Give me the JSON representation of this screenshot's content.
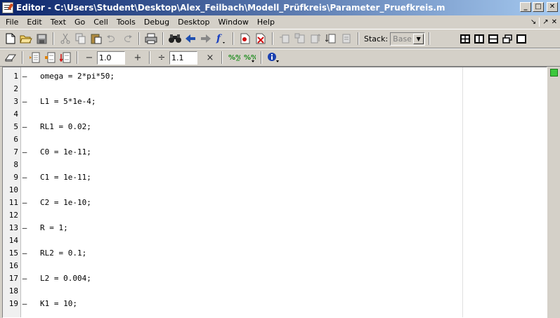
{
  "window": {
    "title": "Editor - C:\\Users\\Student\\Desktop\\Alex_Feilbach\\Modell_Prüfkreis\\Parameter_Pruefkreis.m",
    "minimize": "_",
    "maximize": "□",
    "close": "✕"
  },
  "menu": {
    "items": [
      "File",
      "Edit",
      "Text",
      "Go",
      "Cell",
      "Tools",
      "Debug",
      "Desktop",
      "Window",
      "Help"
    ],
    "right_icons": [
      "↘",
      "↗",
      "✕"
    ]
  },
  "toolbar": {
    "stack_label": "Stack:",
    "stack_value": "Base",
    "minus": "−",
    "step1_value": "1.0",
    "plus": "+",
    "divide": "÷",
    "step2_value": "1.1",
    "times": "×"
  },
  "editor": {
    "lines": [
      {
        "num": "1",
        "bp": "–",
        "code": "omega = 2*pi*50;"
      },
      {
        "num": "2",
        "bp": "",
        "code": ""
      },
      {
        "num": "3",
        "bp": "–",
        "code": "L1 = 5*1e-4;"
      },
      {
        "num": "4",
        "bp": "",
        "code": ""
      },
      {
        "num": "5",
        "bp": "–",
        "code": "RL1 = 0.02;"
      },
      {
        "num": "6",
        "bp": "",
        "code": ""
      },
      {
        "num": "7",
        "bp": "–",
        "code": "C0 = 1e-11;"
      },
      {
        "num": "8",
        "bp": "",
        "code": ""
      },
      {
        "num": "9",
        "bp": "–",
        "code": "C1 = 1e-11;"
      },
      {
        "num": "10",
        "bp": "",
        "code": ""
      },
      {
        "num": "11",
        "bp": "–",
        "code": "C2 = 1e-10;"
      },
      {
        "num": "12",
        "bp": "",
        "code": ""
      },
      {
        "num": "13",
        "bp": "–",
        "code": "R = 1;"
      },
      {
        "num": "14",
        "bp": "",
        "code": ""
      },
      {
        "num": "15",
        "bp": "–",
        "code": "RL2 = 0.1;"
      },
      {
        "num": "16",
        "bp": "",
        "code": ""
      },
      {
        "num": "17",
        "bp": "–",
        "code": "L2 = 0.004;"
      },
      {
        "num": "18",
        "bp": "",
        "code": ""
      },
      {
        "num": "19",
        "bp": "–",
        "code": "K1 = 10;"
      }
    ]
  },
  "colors": {
    "title_gradient_start": "#0a246a",
    "title_gradient_end": "#a6caf0",
    "status_ok": "#3cc83c",
    "chrome": "#d4d0c8"
  }
}
